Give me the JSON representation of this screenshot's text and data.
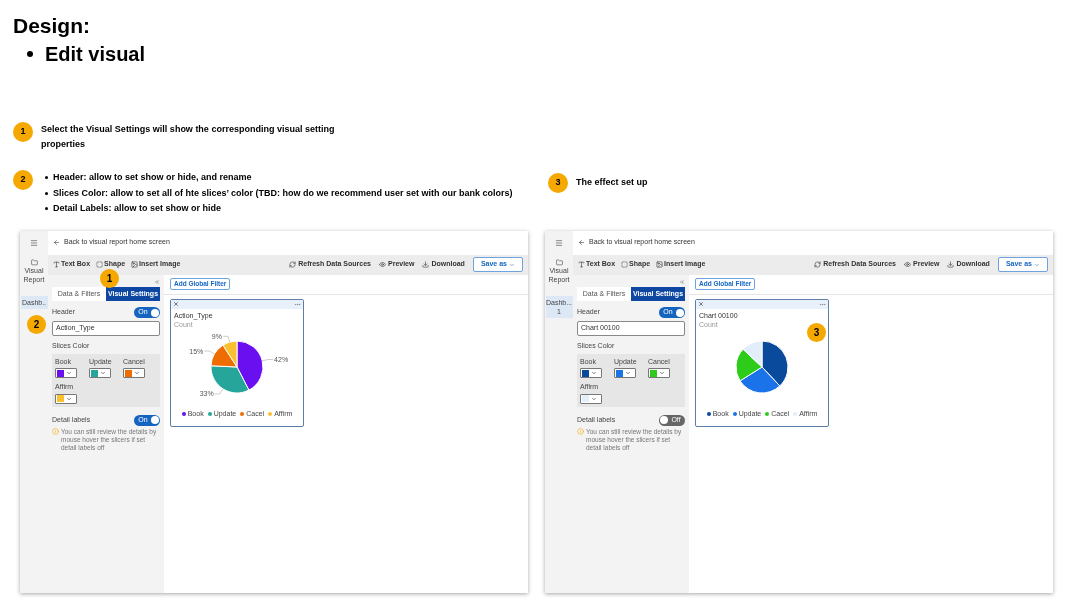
{
  "title": "Design:",
  "bullets": [
    "Edit visual"
  ],
  "note_1": {
    "number": "1",
    "text": "Select the Visual Settings will show the corresponding visual setting properties"
  },
  "note_2": {
    "number": "2",
    "items": [
      "Header: allow to set show or hide, and rename",
      "Slices Color: allow to set all of hte slices’ color (TBD: how do we recommend user set with our bank colors)",
      "Detail Labels: allow to set show or hide"
    ]
  },
  "note_3": {
    "number": "3",
    "text": "The effect set up"
  },
  "screens": [
    {
      "nav_items": [
        {
          "label": "Visual Report",
          "kind": "folder",
          "selected": false
        },
        {
          "label": "Dashb..",
          "kind": "page",
          "selected": true
        }
      ],
      "back_link": "Back to visual report home screen",
      "toolbar_left": [
        {
          "label": "Text Box",
          "kind": "text"
        },
        {
          "label": "Shape",
          "kind": "shape"
        },
        {
          "label": "Insert Image",
          "kind": "image"
        }
      ],
      "toolbar_right": [
        {
          "label": "Refresh Data Sources",
          "kind": "refresh"
        },
        {
          "label": "Preview",
          "kind": "preview"
        },
        {
          "label": "Download",
          "kind": "download"
        }
      ],
      "save_button": "Save as",
      "tabs": [
        {
          "label": "Data & Filters",
          "selected": false
        },
        {
          "label": "Visual Settings",
          "selected": true
        }
      ],
      "header": {
        "label": "Header",
        "on": true,
        "toggle_text": "On",
        "value": "Action_Type"
      },
      "slices": {
        "label": "Slices Color",
        "items": [
          {
            "name": "Book",
            "color": "#6a0ff0"
          },
          {
            "name": "Update",
            "color": "#26a69a"
          },
          {
            "name": "Cancel",
            "color": "#ef6c00"
          },
          {
            "name": "Affirm",
            "color": "#fbc02d"
          }
        ]
      },
      "detail_labels": {
        "label": "Detail labels",
        "on": true,
        "toggle_text": "On",
        "hint": "You can still review the details by mouse hover the slicers if set detail labels off"
      },
      "add_filter": "Add Global Filter",
      "card": {
        "title": "Action_Type",
        "subtitle": "Count",
        "chart_data": {
          "type": "pie",
          "categories": [
            "Book",
            "Update",
            "Cacel",
            "Affirm"
          ],
          "values": [
            42,
            33,
            15,
            9
          ],
          "value_labels": [
            "42%",
            "33%",
            "15%",
            "9%"
          ]
        }
      },
      "annotations": [
        {
          "number": "1",
          "kind": "tab"
        },
        {
          "number": "2",
          "kind": "header"
        }
      ]
    },
    {
      "nav_items": [
        {
          "label": "Visual Report",
          "kind": "folder",
          "selected": false
        },
        {
          "label": "Dashb...",
          "sub": "1",
          "kind": "page",
          "selected": true
        }
      ],
      "back_link": "Back to visual report home screen",
      "toolbar_left": [
        {
          "label": "Text Box",
          "kind": "text"
        },
        {
          "label": "Shape",
          "kind": "shape"
        },
        {
          "label": "Insert Image",
          "kind": "image"
        }
      ],
      "toolbar_right": [
        {
          "label": "Refresh Data Sources",
          "kind": "refresh"
        },
        {
          "label": "Preview",
          "kind": "preview"
        },
        {
          "label": "Download",
          "kind": "download"
        }
      ],
      "save_button": "Save as",
      "tabs": [
        {
          "label": "Data & Filters",
          "selected": false
        },
        {
          "label": "Visual Settings",
          "selected": true
        }
      ],
      "header": {
        "label": "Header",
        "on": true,
        "toggle_text": "On",
        "value": "Chart 00100"
      },
      "slices": {
        "label": "Slices Color",
        "items": [
          {
            "name": "Book",
            "color": "#0a4a9c"
          },
          {
            "name": "Update",
            "color": "#1a73e8"
          },
          {
            "name": "Cancel",
            "color": "#2ecc1a"
          },
          {
            "name": "Affirm",
            "color": "#e3eefb"
          }
        ]
      },
      "detail_labels": {
        "label": "Detail labels",
        "on": false,
        "toggle_text": "Off",
        "hint": "You can still review the details by mouse hover the slicers if set detail labels off"
      },
      "add_filter": "Add Global Filter",
      "card": {
        "title": "Chart 00100",
        "subtitle": "Count",
        "legend": [
          "Book",
          "Update",
          "Cacel",
          "Affirm"
        ]
      },
      "annotations": [
        {
          "number": "3",
          "kind": "card"
        }
      ]
    }
  ]
}
